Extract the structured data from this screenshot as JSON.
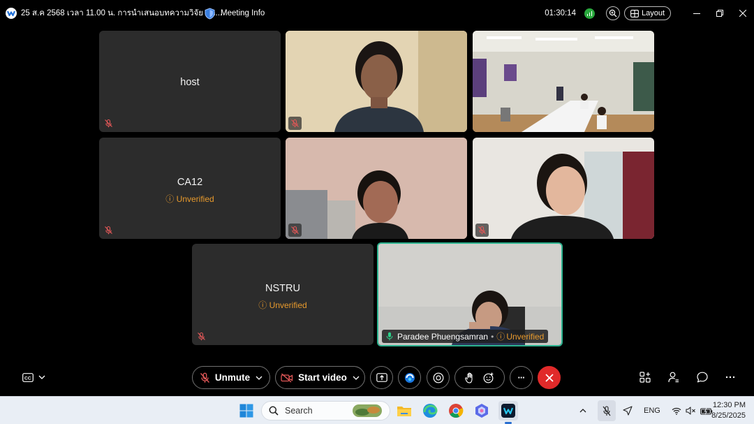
{
  "titlebar": {
    "title": "25 ส.ค 2568 เวลา 11.00 น. การนำเสนอบทความวิจัย ห้อ...",
    "meeting_info": "Meeting Info",
    "timer": "01:30:14",
    "layout_label": "Layout"
  },
  "tiles": [
    {
      "name": "host"
    },
    {
      "name": "CA12",
      "status": "Unverified"
    },
    {
      "name": "NSTRU",
      "status": "Unverified"
    }
  ],
  "active_speaker": {
    "name": "Paradee Phuengsamran",
    "separator": "•",
    "status": "Unverified"
  },
  "controls": {
    "unmute_label": "Unmute",
    "start_video_label": "Start video",
    "more_label": "···"
  },
  "taskbar": {
    "search_placeholder": "Search",
    "lang": "ENG",
    "time": "12:30 PM",
    "date": "8/25/2025"
  },
  "colors": {
    "accent_green": "#2bb38f",
    "unverified": "#e89a2c",
    "hangup_red": "#e12a2a",
    "tile_bg": "#2c2c2c"
  }
}
